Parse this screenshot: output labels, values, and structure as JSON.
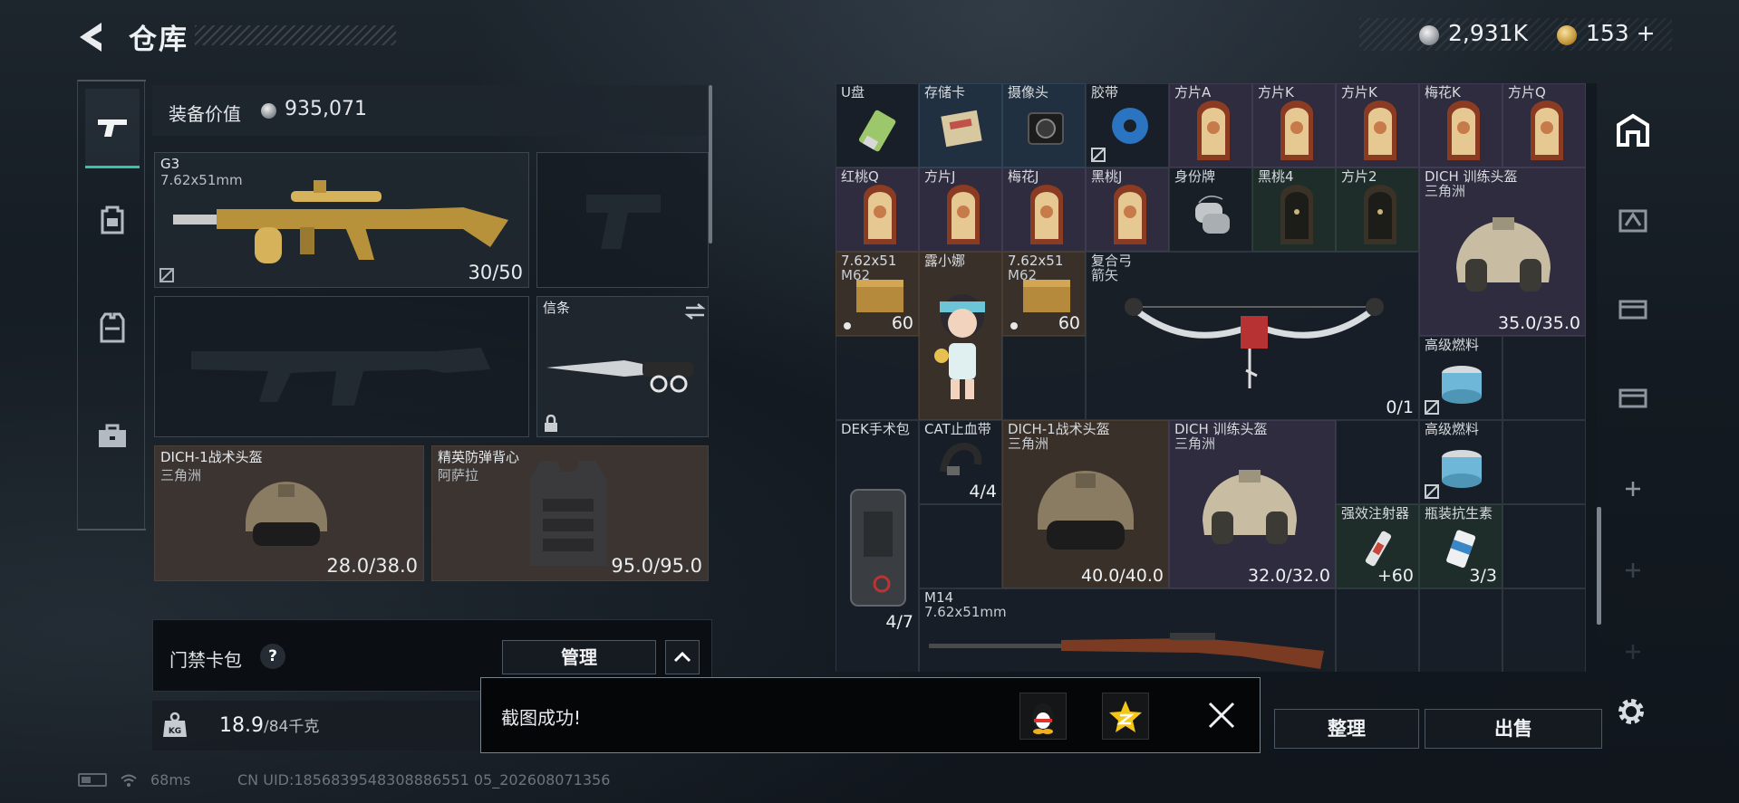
{
  "header": {
    "title": "仓库",
    "silver": "2,931K",
    "gold": "153",
    "gold_add": "+"
  },
  "equip": {
    "label": "装备价值",
    "value": "935,071"
  },
  "slots": {
    "primary": {
      "name": "G3",
      "caliber": "7.62x51mm",
      "ammo": "30/50"
    },
    "melee": {
      "name": "信条"
    },
    "helmet": {
      "name": "DICH-1战术头盔",
      "sub": "三角洲",
      "durability": "28.0/38.0"
    },
    "armor": {
      "name": "精英防弹背心",
      "sub": "阿萨拉",
      "durability": "95.0/95.0"
    }
  },
  "card_pack": {
    "label": "门禁卡包",
    "help": "?",
    "manage": "管理",
    "collapse": "^"
  },
  "weight": {
    "current": "18.9",
    "max": "/84千克",
    "unit_icon": "KG"
  },
  "grid": [
    {
      "name": "U盘"
    },
    {
      "name": "存储卡"
    },
    {
      "name": "摄像头"
    },
    {
      "name": "胶带"
    },
    {
      "name": "方片A"
    },
    {
      "name": "方片K"
    },
    {
      "name": "方片K"
    },
    {
      "name": "梅花K"
    },
    {
      "name": "方片Q"
    },
    {
      "name": "红桃Q"
    },
    {
      "name": "方片J"
    },
    {
      "name": "梅花J"
    },
    {
      "name": "黑桃J"
    },
    {
      "name": "身份牌"
    },
    {
      "name": "黑桃4"
    },
    {
      "name": "方片2"
    },
    {
      "name": "DICH 训练头盔",
      "sub": "三角洲",
      "value": "35.0/35.0"
    },
    {
      "name": "7.62x51",
      "sub": "M62",
      "value": "60"
    },
    {
      "name": "露小娜"
    },
    {
      "name": "7.62x51",
      "sub": "M62",
      "value": "60"
    },
    {
      "name": "复合弓",
      "sub": "箭矢",
      "value": "0/1"
    },
    {
      "name": "高级燃料"
    },
    {
      "name": "DEK手术包",
      "value": "4/7"
    },
    {
      "name": "CAT止血带",
      "value": "4/4"
    },
    {
      "name": "DICH-1战术头盔",
      "sub": "三角洲",
      "value": "40.0/40.0"
    },
    {
      "name": "DICH 训练头盔",
      "sub": "三角洲",
      "value": "32.0/32.0"
    },
    {
      "name": "高级燃料"
    },
    {
      "name": "强效注射器",
      "value": "+60"
    },
    {
      "name": "瓶装抗生素",
      "value": "3/3"
    },
    {
      "name": "M14",
      "sub": "7.62x51mm"
    }
  ],
  "actions": {
    "sort": "整理",
    "sell": "出售"
  },
  "toast": {
    "message": "截图成功!"
  },
  "status": {
    "ping": "68ms",
    "uid": "CN UID:1856839548308886551 05_202608071356"
  },
  "colors": {
    "accent": "#35c4a5",
    "brown_slot": "#3b3430",
    "purple_slot": "#2e2c3e"
  }
}
